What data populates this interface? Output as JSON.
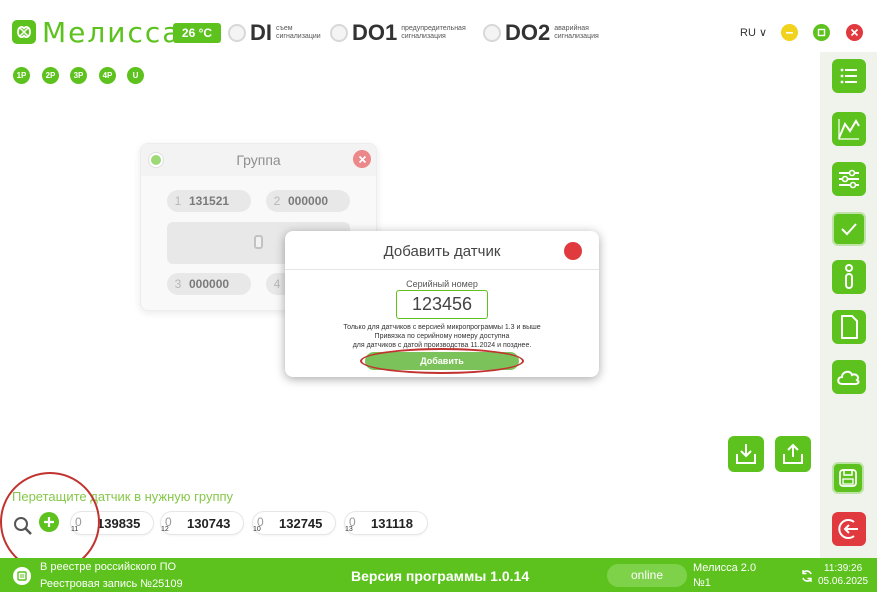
{
  "header": {
    "title": "Мелисса",
    "temperature": "26 °C",
    "indicators": [
      {
        "code": "DI",
        "desc": "съем сигнализации"
      },
      {
        "code": "DO1",
        "desc": "предупредительная сигнализация"
      },
      {
        "code": "DO2",
        "desc": "аварийная сигнализация"
      }
    ],
    "language": "RU ∨"
  },
  "ports": [
    "1P",
    "2P",
    "3P",
    "4P",
    "U"
  ],
  "group": {
    "title": "Группа",
    "slots": [
      {
        "num": "1",
        "serial": "131521"
      },
      {
        "num": "2",
        "serial": "000000"
      },
      {
        "num": "3",
        "serial": "000000"
      },
      {
        "num": "4",
        "serial": ""
      }
    ]
  },
  "dialog": {
    "title": "Добавить датчик",
    "serial_label": "Серийный номер",
    "serial_value": "123456",
    "note_1": "Только для датчиков с версией микропрограммы 1.3 и выше",
    "note_2": "Привязка по серийному номеру доступна",
    "note_3": "для датчиков с датой производства 11.2024 и позднее.",
    "add_label": "Добавить"
  },
  "bottom": {
    "drop_hint": "Перетащите датчик в нужную группу",
    "sensors": [
      {
        "signal": "0",
        "sub": "11",
        "serial": "139835"
      },
      {
        "signal": "0",
        "sub": "12",
        "serial": "130743"
      },
      {
        "signal": "0",
        "sub": "10",
        "serial": "132745"
      },
      {
        "signal": "0",
        "sub": "13",
        "serial": "131118"
      }
    ]
  },
  "footer": {
    "registry_line1": "В реестре российского ПО",
    "registry_line2": "Реестровая запись №25109",
    "version": "Версия программы  1.0.14",
    "status": "online",
    "device_line1": "Мелисса 2.0",
    "device_line2": "№1",
    "time": "11:39:26",
    "date": "05.06.2025"
  },
  "colors": {
    "accent": "#5dc21e",
    "danger": "#e0393e",
    "warning": "#f1d21c",
    "annotation": "#c0332e"
  },
  "icons": {
    "logo": "melissa-logo-icon",
    "sidebar": [
      "list-icon",
      "chart-icon",
      "sliders-icon",
      "check-icon",
      "info-icon",
      "document-icon",
      "cloud-icon",
      "save-icon",
      "logout-icon"
    ]
  }
}
